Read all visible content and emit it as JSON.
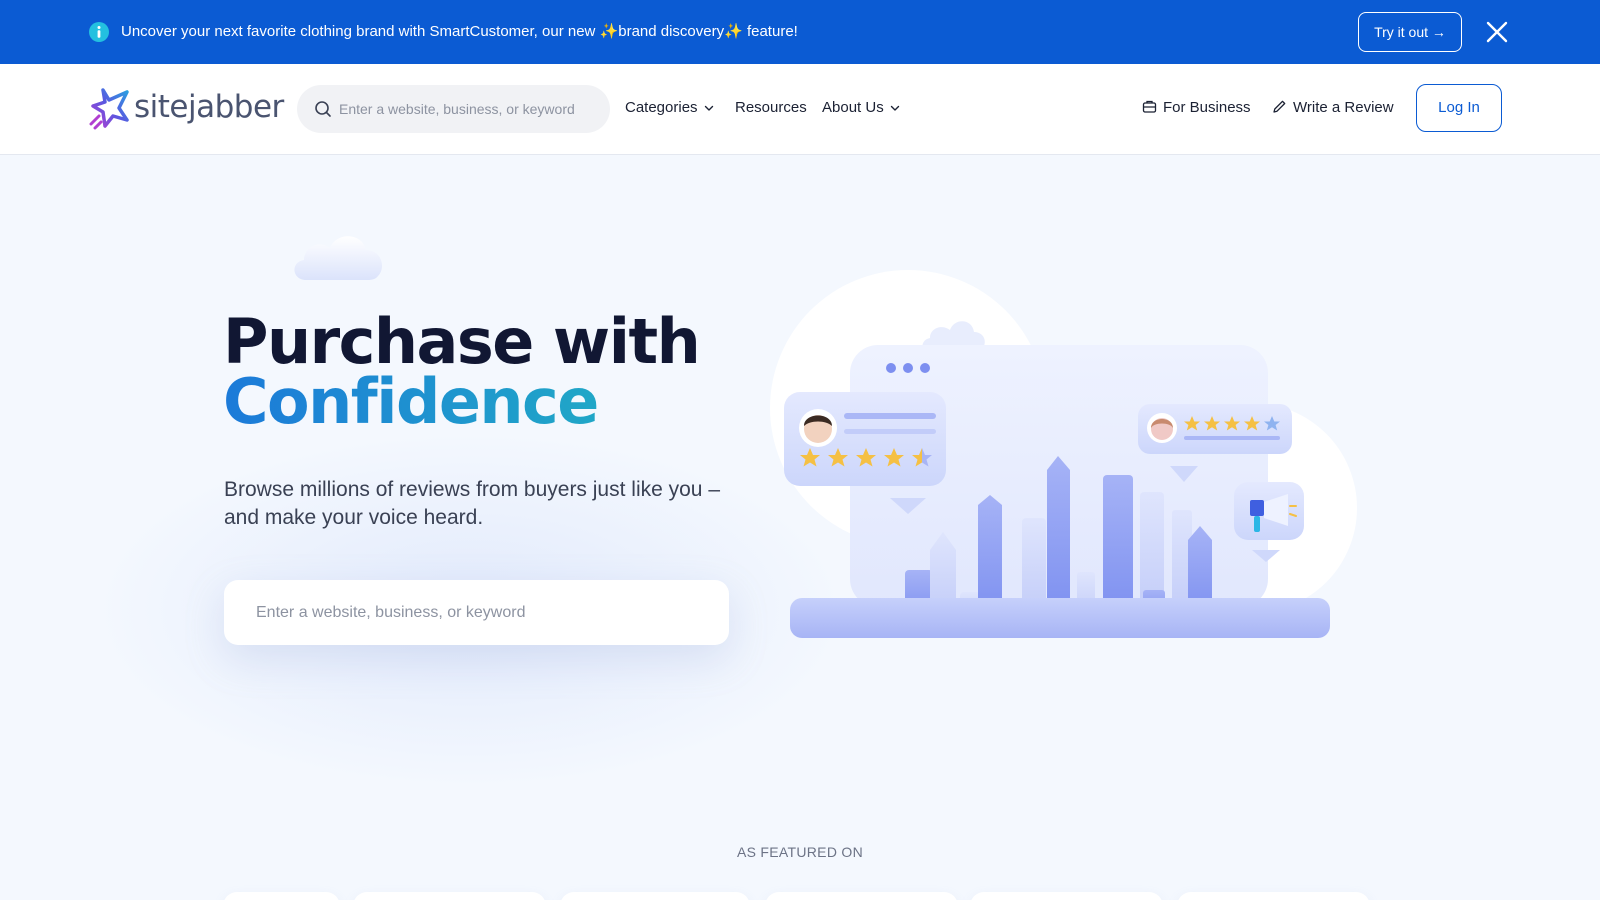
{
  "banner": {
    "text": "Uncover your next favorite clothing brand with SmartCustomer, our new ✨brand discovery✨ feature!",
    "cta_label": "Try it out →"
  },
  "header": {
    "logo_text": "sitejabber",
    "search_placeholder": "Enter a website, business, or keyword",
    "nav": [
      {
        "label": "Categories"
      },
      {
        "label": "Resources"
      },
      {
        "label": "About Us"
      }
    ],
    "for_business": "For Business",
    "write_review": "Write a Review",
    "login": "Log In"
  },
  "hero": {
    "title_line1": "Purchase with",
    "title_line2": "Confidence",
    "subtitle": "Browse millions of reviews from buyers just like you – and make your voice heard.",
    "search_placeholder": "Enter a website, business, or keyword"
  },
  "featured": {
    "label": "AS FEATURED ON"
  },
  "icons": {
    "banner_info": "info-icon",
    "banner_close": "close-icon",
    "search": "search-icon",
    "chevron": "chevron-down-icon",
    "briefcase": "briefcase-icon",
    "pencil": "pencil-icon"
  },
  "colors": {
    "brand_blue": "#0b5bd3",
    "accent_cyan": "#20a7c7",
    "title_dark": "#111733",
    "star_gold": "#f5c044",
    "chart_purple": "#8a9cf3"
  },
  "illustration": {
    "card_left_rating": 4.5,
    "card_right_rating": 4.5
  }
}
